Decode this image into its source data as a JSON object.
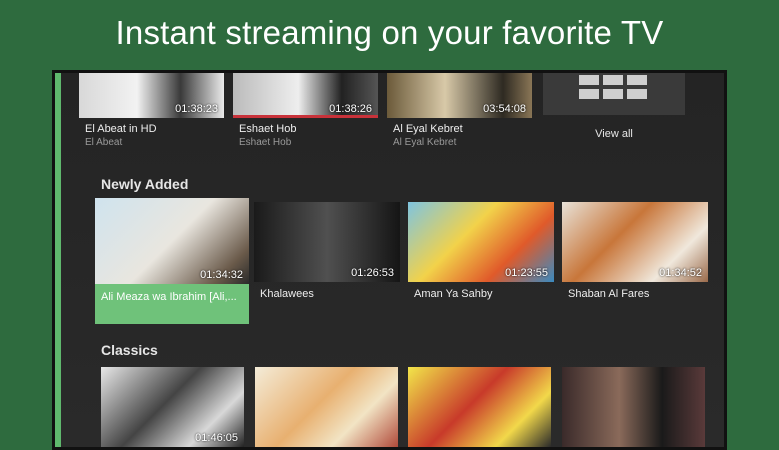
{
  "headline": "Instant streaming on your favorite TV",
  "top_row": {
    "items": [
      {
        "title": "El Abeat in HD",
        "subtitle": "El Abeat",
        "duration": "01:38:23"
      },
      {
        "title": "Eshaet Hob",
        "subtitle": "Eshaet Hob",
        "duration": "01:38:26"
      },
      {
        "title": "Al Eyal Kebret",
        "subtitle": "Al Eyal Kebret",
        "duration": "03:54:08"
      }
    ],
    "view_all_label": "View all"
  },
  "newly_added": {
    "title": "Newly Added",
    "items": [
      {
        "title": "Ali Meaza wa Ibrahim [Ali,...",
        "duration": "01:34:32"
      },
      {
        "title": "Khalawees",
        "duration": "01:26:53"
      },
      {
        "title": "Aman Ya Sahby",
        "duration": "01:23:55"
      },
      {
        "title": "Shaban Al Fares",
        "duration": "01:34:52"
      }
    ]
  },
  "classics": {
    "title": "Classics",
    "items": [
      {
        "duration": "01:46:05"
      },
      {
        "duration": ""
      },
      {
        "duration": ""
      },
      {
        "duration": ""
      }
    ]
  },
  "colors": {
    "background": "#2e6b3e",
    "accent": "#5fb86d",
    "focused_card": "#6fc27a"
  }
}
